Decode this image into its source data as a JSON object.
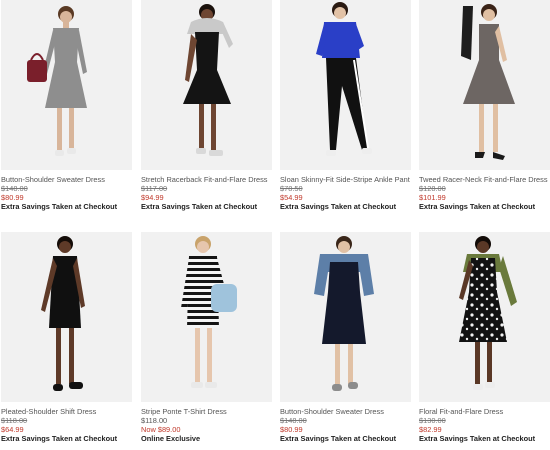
{
  "products": [
    {
      "name": "Button-Shoulder Sweater Dress",
      "was_price": "$148.00",
      "now_price": "$80.99",
      "promo": "Extra Savings Taken at Checkout",
      "photo": {
        "dress_color": "#8e8e8e",
        "accent_color": "#7a1f2b",
        "skin_color": "#d8b59a",
        "hair_color": "#5a3a24"
      }
    },
    {
      "name": "Stretch Racerback Fit-and-Flare Dress",
      "was_price": "$117.00",
      "now_price": "$94.99",
      "promo": "Extra Savings Taken at Checkout",
      "photo": {
        "dress_color": "#141414",
        "accent_color": "#c9c9c9",
        "skin_color": "#6e4632",
        "hair_color": "#1b120d"
      }
    },
    {
      "name": "Sloan Skinny-Fit Side-Stripe Ankle Pant",
      "was_price": "$78.50",
      "now_price": "$54.99",
      "promo": "Extra Savings Taken at Checkout",
      "photo": {
        "dress_color": "#2a3fc7",
        "accent_color": "#111111",
        "skin_color": "#e2c2a6",
        "hair_color": "#2a1a12"
      }
    },
    {
      "name": "Tweed Racer-Neck Fit-and-Flare Dress",
      "was_price": "$128.00",
      "now_price": "$101.99",
      "promo": "Extra Savings Taken at Checkout",
      "photo": {
        "dress_color": "#6d6663",
        "accent_color": "#1e1e1e",
        "skin_color": "#e0bfa2",
        "hair_color": "#3b2418"
      }
    },
    {
      "name": "Pleated-Shoulder Shift Dress",
      "was_price": "$118.00",
      "now_price": "$64.99",
      "promo": "Extra Savings Taken at Checkout",
      "photo": {
        "dress_color": "#101010",
        "accent_color": "#101010",
        "skin_color": "#5e3a28",
        "hair_color": "#140c08"
      }
    },
    {
      "name": "Stripe Ponte T-Shirt Dress",
      "regular_price": "$118.00",
      "now_price": "Now $89.00",
      "promo": "Online Exclusive",
      "photo": {
        "dress_color": "#1a1a1a",
        "accent_color": "#9fc3dc",
        "skin_color": "#e6c6ad",
        "hair_color": "#c9a36b"
      }
    },
    {
      "name": "Button-Shoulder Sweater Dress",
      "was_price": "$148.00",
      "now_price": "$80.99",
      "promo": "Extra Savings Taken at Checkout",
      "photo": {
        "dress_color": "#14192c",
        "accent_color": "#5d7fa8",
        "skin_color": "#e1c1a5",
        "hair_color": "#3a2619"
      }
    },
    {
      "name": "Floral Fit-and-Flare Dress",
      "was_price": "$130.00",
      "now_price": "$82.99",
      "promo": "Extra Savings Taken at Checkout",
      "photo": {
        "dress_color": "#111111",
        "accent_color": "#6a7a3c",
        "skin_color": "#5a3826",
        "hair_color": "#120b07"
      }
    }
  ]
}
